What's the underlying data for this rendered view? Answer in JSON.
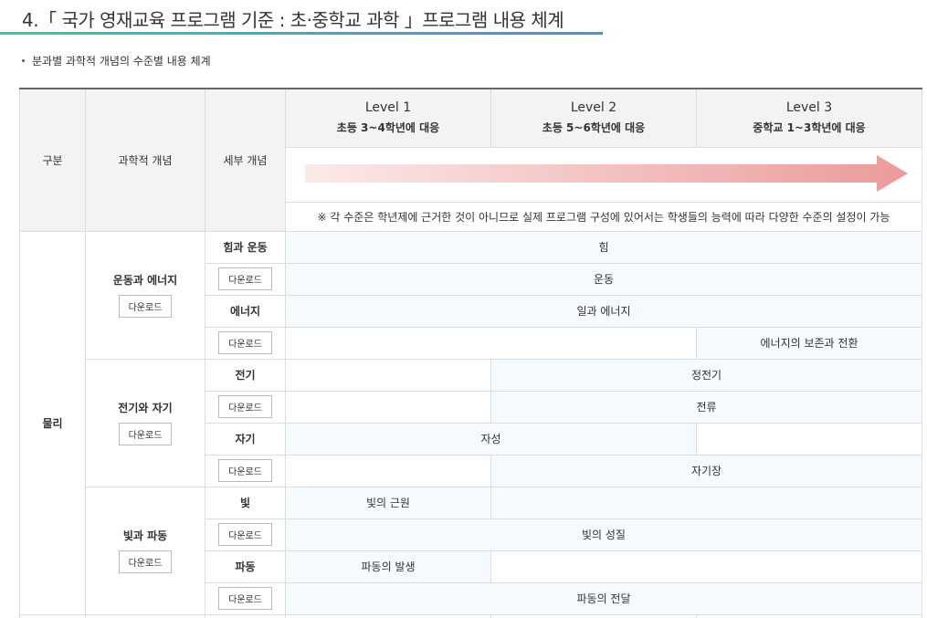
{
  "header": {
    "title": "4.「 국가 영재교육 프로그램 기준 : 초·중학교 과학 」프로그램 내용 체계",
    "subtitle": "분과별 과학적 개념의 수준별 내용 체계"
  },
  "table": {
    "col_category": "구분",
    "col_concept": "과학적 개념",
    "col_detail": "세부 개념",
    "levels": [
      {
        "name": "Level 1",
        "desc": "초등 3~4학년에 대응"
      },
      {
        "name": "Level 2",
        "desc": "초등 5~6학년에 대응"
      },
      {
        "name": "Level 3",
        "desc": "중학교 1~3학년에 대응"
      }
    ],
    "note": "※ 각 수준은 학년제에 근거한 것이 아니므로 실제 프로그램 구성에 있어서는 학생들의 능력에 따라 다양한 수준의 설정이 가능",
    "download_label": "다운로드",
    "arrow_colors": {
      "start": "#fbeaea",
      "end": "#eb9a9a"
    },
    "category": "물리",
    "groups": [
      {
        "name": "운동과 에너지",
        "subs": [
          {
            "name": "힘과 운동",
            "rows": [
              "힘",
              "운동"
            ]
          },
          {
            "name": "에너지",
            "rows": [
              "일과 에너지",
              "에너지의 보존과 전환"
            ]
          }
        ]
      },
      {
        "name": "전기와 자기",
        "subs": [
          {
            "name": "전기",
            "rows": [
              "정전기",
              "전류"
            ]
          },
          {
            "name": "자기",
            "rows": [
              "자성",
              "자기장"
            ]
          }
        ]
      },
      {
        "name": "빛과 파동",
        "subs": [
          {
            "name": "빛",
            "rows": [
              "빛의 근원",
              "빛의 성질"
            ]
          },
          {
            "name": "파동",
            "rows": [
              "파동의 발생",
              "파동의 전달"
            ]
          }
        ]
      }
    ]
  }
}
